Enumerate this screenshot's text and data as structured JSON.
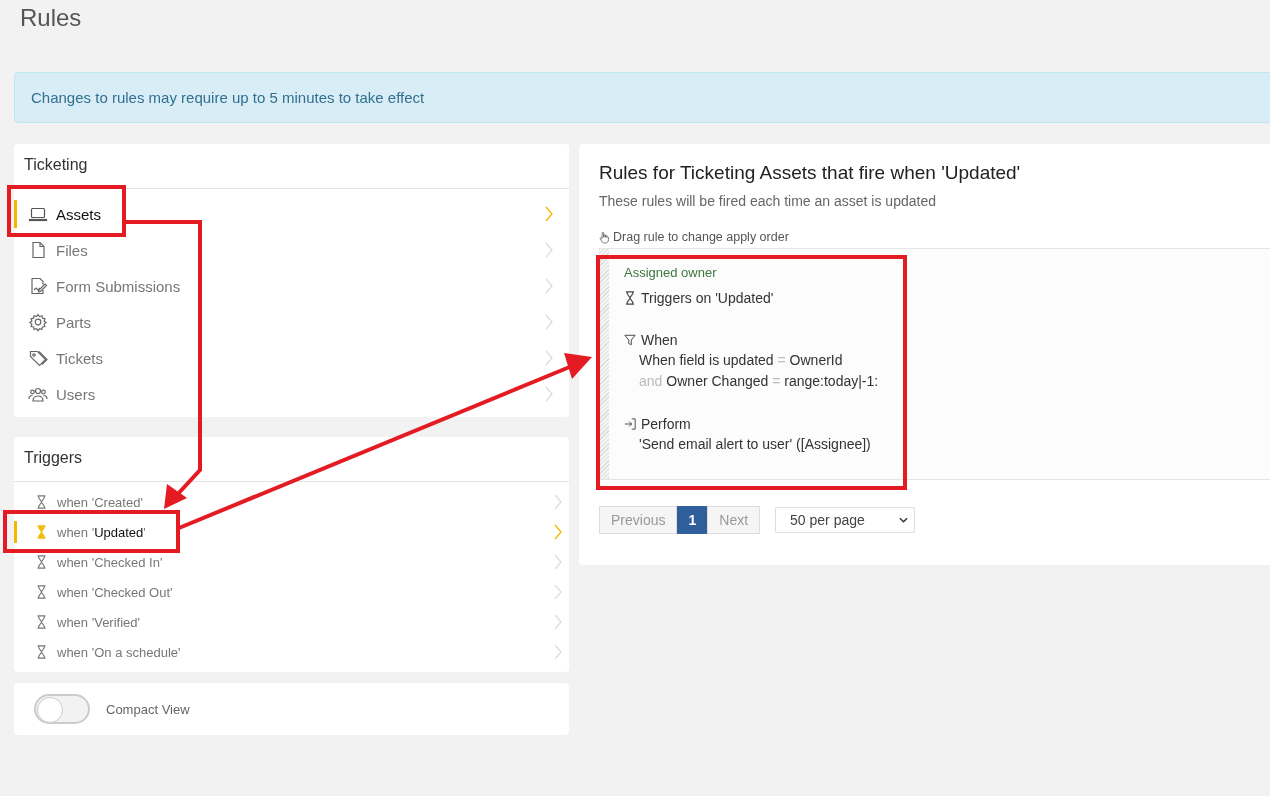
{
  "page_title": "Rules",
  "alert": "Changes to rules may require up to 5 minutes to take effect",
  "modules": {
    "title": "Ticketing",
    "items": [
      {
        "label": "Assets",
        "selected": true
      },
      {
        "label": "Files",
        "selected": false
      },
      {
        "label": "Form Submissions",
        "selected": false
      },
      {
        "label": "Parts",
        "selected": false
      },
      {
        "label": "Tickets",
        "selected": false
      },
      {
        "label": "Users",
        "selected": false
      }
    ]
  },
  "triggers": {
    "title": "Triggers",
    "items": [
      {
        "label": "when 'Created'",
        "selected": false
      },
      {
        "label": "when '**Updated**'",
        "selected": true
      },
      {
        "label": "when 'Checked In'",
        "selected": false
      },
      {
        "label": "when 'Checked Out'",
        "selected": false
      },
      {
        "label": "when 'Verified'",
        "selected": false
      },
      {
        "label": "when 'On a schedule'",
        "selected": false
      }
    ]
  },
  "compact_view": {
    "label": "Compact View",
    "checked": false
  },
  "rules_panel": {
    "title": "Rules for Ticketing Assets that fire when 'Updated'",
    "subtitle": "These rules will be fired each time an asset is updated",
    "drag_hint": "Drag rule to change apply order",
    "rules": [
      {
        "name": "Assigned owner",
        "trigger": "Triggers on 'Updated'",
        "when_label": "When",
        "conditions": [
          {
            "field": "When field is updated",
            "op": "=",
            "value": "OwnerId"
          },
          {
            "joiner": "and",
            "field": "Owner Changed",
            "op": "=",
            "value": "range:today|-1:"
          }
        ],
        "perform_label": "Perform",
        "action": "'Send email alert to user' ([Assignee])"
      }
    ],
    "pagination": {
      "previous": {
        "label": "Previous",
        "disabled": true
      },
      "pages": [
        {
          "label": "1",
          "selected": true
        }
      ],
      "next": {
        "label": "Next",
        "disabled": true
      }
    },
    "page_size": "50 per page"
  }
}
